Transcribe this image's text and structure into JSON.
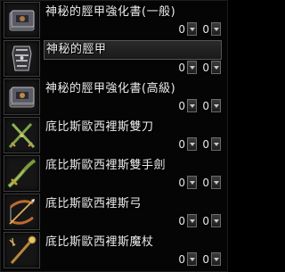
{
  "items": [
    {
      "name": "神秘的脛甲強化書(一般)",
      "qty_a": "0",
      "qty_b": "0",
      "icon": "book-icon"
    },
    {
      "name": "神秘的脛甲",
      "qty_a": "0",
      "qty_b": "0",
      "icon": "greaves-icon"
    },
    {
      "name": "神秘的脛甲強化書(高級)",
      "qty_a": "0",
      "qty_b": "0",
      "icon": "book-icon"
    },
    {
      "name": "底比斯歐西裡斯雙刀",
      "qty_a": "0",
      "qty_b": "0",
      "icon": "dual-blades-icon"
    },
    {
      "name": "底比斯歐西裡斯雙手劍",
      "qty_a": "0",
      "qty_b": "0",
      "icon": "two-handed-sword-icon"
    },
    {
      "name": "底比斯歐西裡斯弓",
      "qty_a": "0",
      "qty_b": "0",
      "icon": "bow-icon"
    },
    {
      "name": "底比斯歐西裡斯魔杖",
      "qty_a": "0",
      "qty_b": "0",
      "icon": "staff-icon"
    }
  ]
}
